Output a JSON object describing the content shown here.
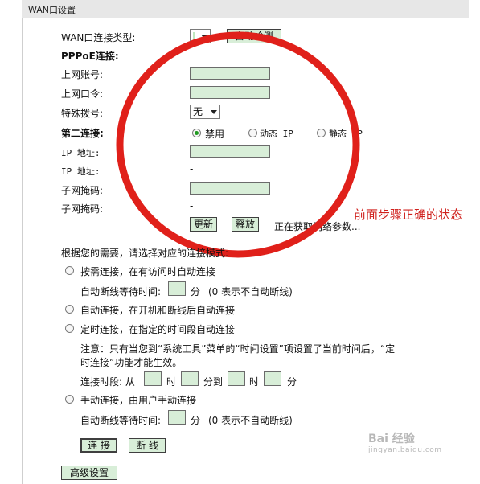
{
  "window": {
    "title": "WAN口设置"
  },
  "connection_type": {
    "label": "WAN口连接类型:",
    "detect_button": "自动检测"
  },
  "pppoe": {
    "section_label": "PPPoE连接:",
    "account_label": "上网账号:",
    "password_label": "上网口令:",
    "dial_label": "特殊拨号:",
    "dial_value": "无"
  },
  "second_connection": {
    "label": "第二连接:",
    "options": [
      "禁用",
      "动态 IP",
      "静态 IP"
    ],
    "selected": "禁用",
    "ip_label": "IP 地址:",
    "ip_label_2": "IP 地址:",
    "ip_value_2": "-",
    "mask_label": "子网掩码:",
    "mask_label_2": "子网掩码:",
    "mask_value_2": "-",
    "renew_button": "更新",
    "release_button": "释放",
    "status_text": "正在获取网络参数..."
  },
  "annotation": {
    "text": "前面步骤正确的状态",
    "color": "#d0201c"
  },
  "modes": {
    "intro": "根据您的需要，请选择对应的连接模式:",
    "on_demand": "按需连接，在有访问时自动连接",
    "idle_label": "自动断线等待时间:",
    "idle_unit": "分",
    "idle_note": "(0 表示不自动断线)",
    "auto": "自动连接，在开机和断线后自动连接",
    "timed": "定时连接，在指定的时间段自动连接",
    "timed_note_line1": "注意：只有当您到“系统工具”菜单的“时间设置”项设置了当前时间后，“定",
    "timed_note_line2": "时连接”功能才能生效。",
    "period_label": "连接时段: 从",
    "period_hour": "时",
    "period_to": "分到",
    "period_hour2": "时",
    "period_min": "分",
    "manual": "手动连接，由用户手动连接",
    "manual_idle_label": "自动断线等待时间:",
    "manual_idle_unit": "分",
    "manual_idle_note": "(0 表示不自动断线)"
  },
  "buttons": {
    "connect": "连 接",
    "disconnect": "断 线",
    "advanced": "高级设置"
  },
  "watermark": {
    "brand": "Bai 经验",
    "url": "jingyan.baidu.com"
  }
}
